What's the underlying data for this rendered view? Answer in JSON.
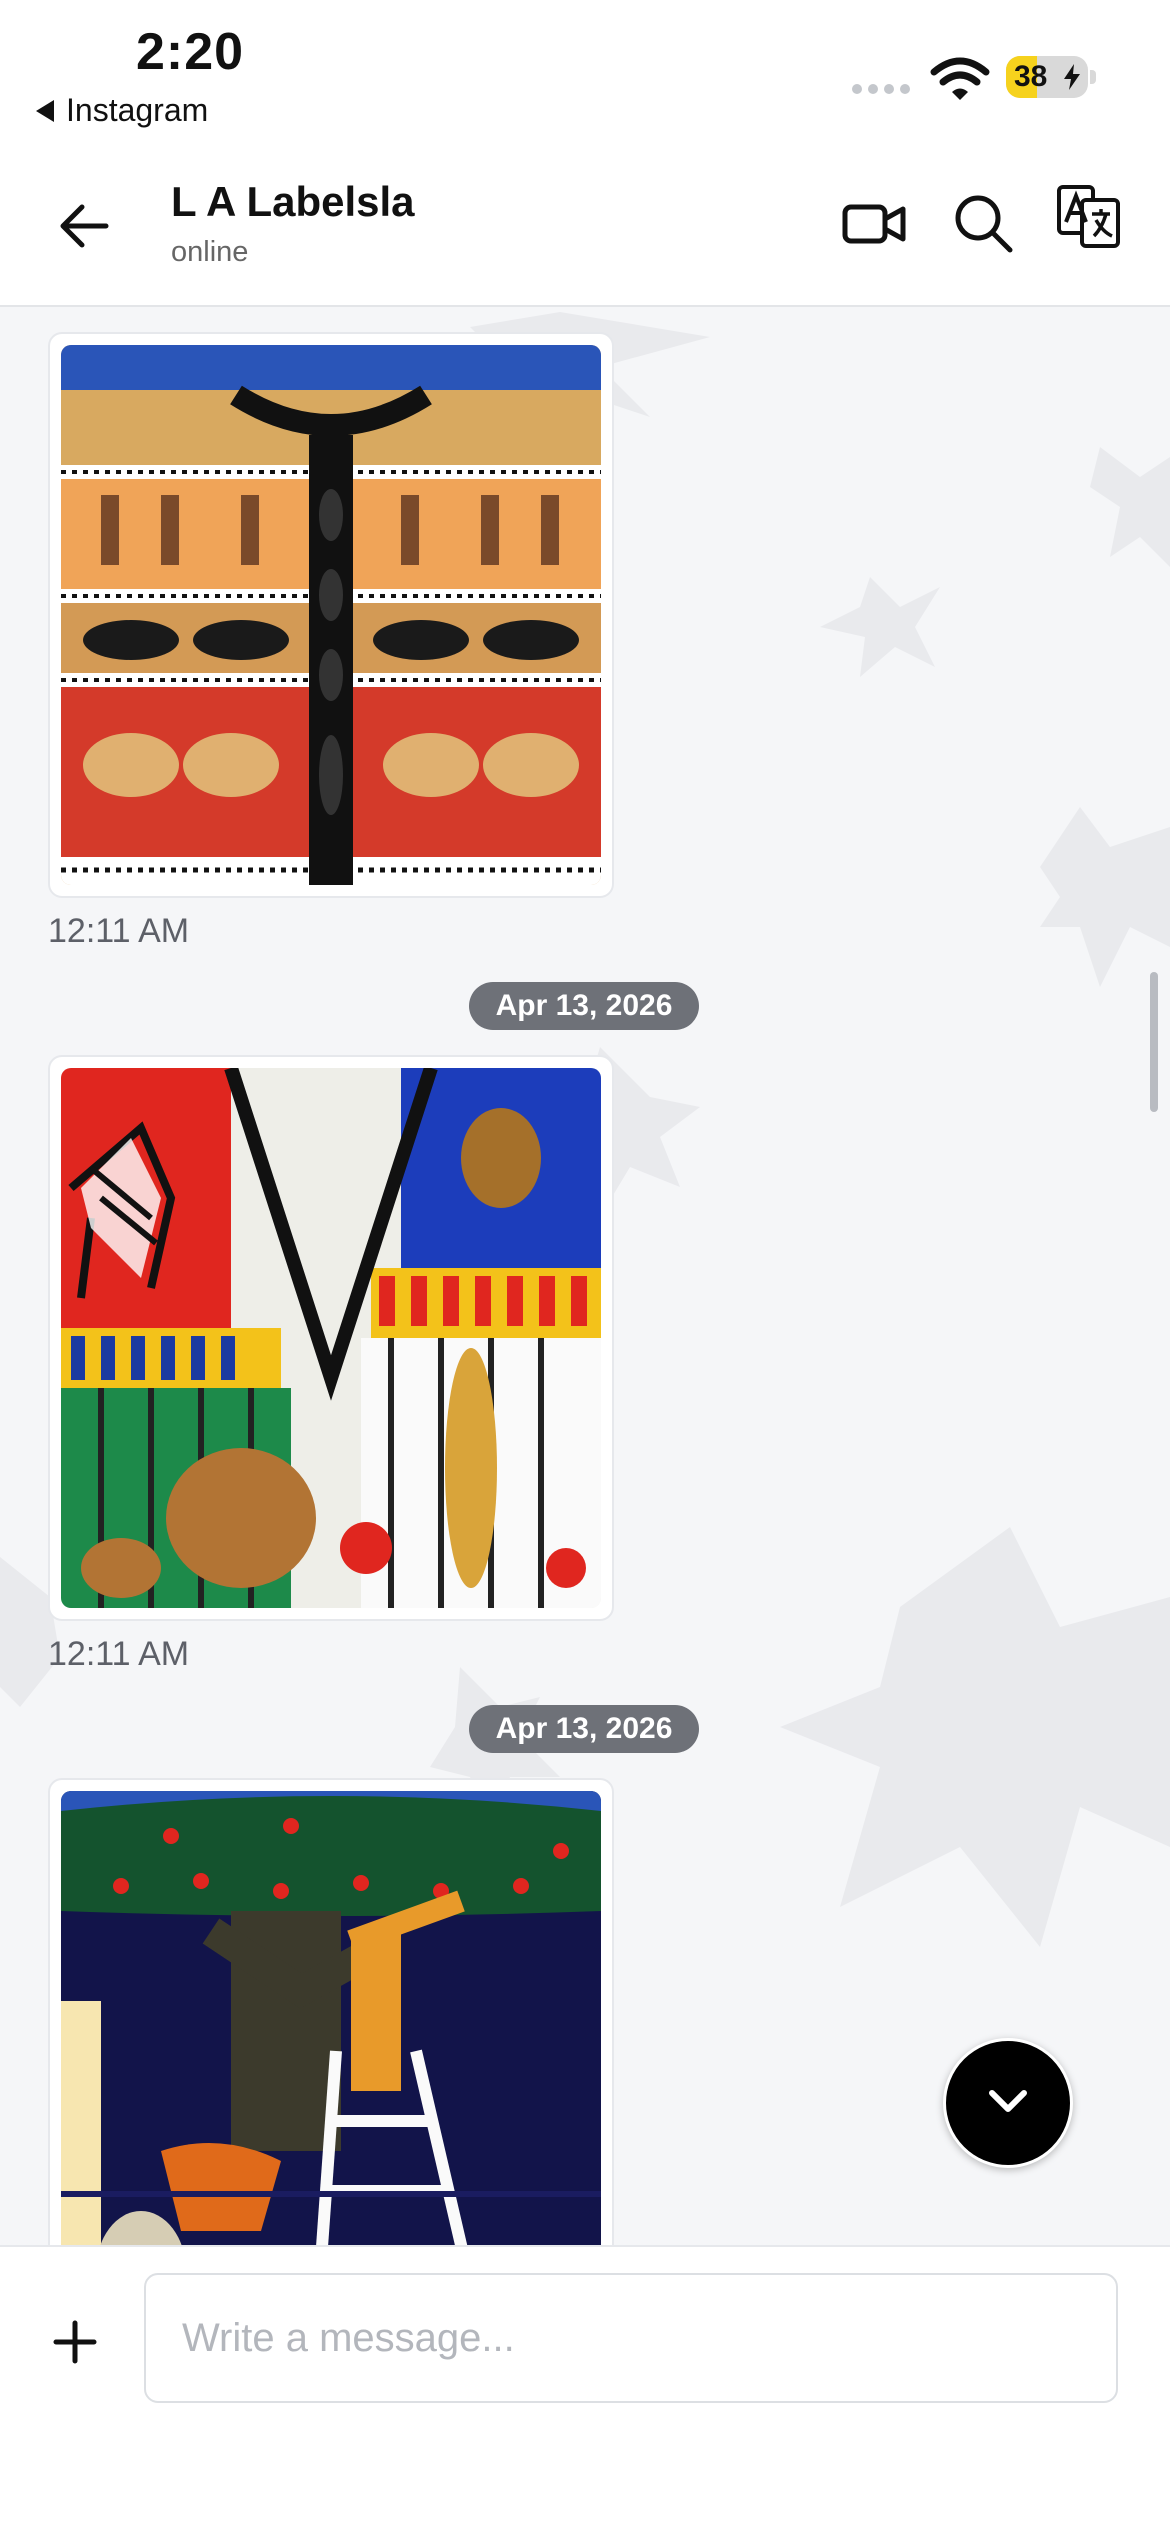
{
  "status_bar": {
    "time": "2:20",
    "back_app": "Instagram",
    "battery": "38",
    "battery_level": 0.38
  },
  "header": {
    "title": "L A Labelsla",
    "subtitle": "online",
    "icons": [
      "arrow-left-icon",
      "video-call-icon",
      "search-icon",
      "translate-icon"
    ]
  },
  "messages": [
    {
      "type": "image",
      "image": "knitted-safari-cardigan",
      "time": "12:11 AM"
    },
    {
      "type": "date",
      "label": "Apr 13, 2026"
    },
    {
      "type": "image",
      "image": "knitted-zoo-vest",
      "time": "12:11 AM"
    },
    {
      "type": "date",
      "label": "Apr 13, 2026"
    },
    {
      "type": "image",
      "image": "knitted-apple-tree-sweater"
    }
  ],
  "composer": {
    "placeholder": "Write a message..."
  },
  "colors": {
    "accent": "#000000",
    "date_pill": "#6e7178",
    "battery": "#f6d21d",
    "background": "#f5f6f8"
  }
}
